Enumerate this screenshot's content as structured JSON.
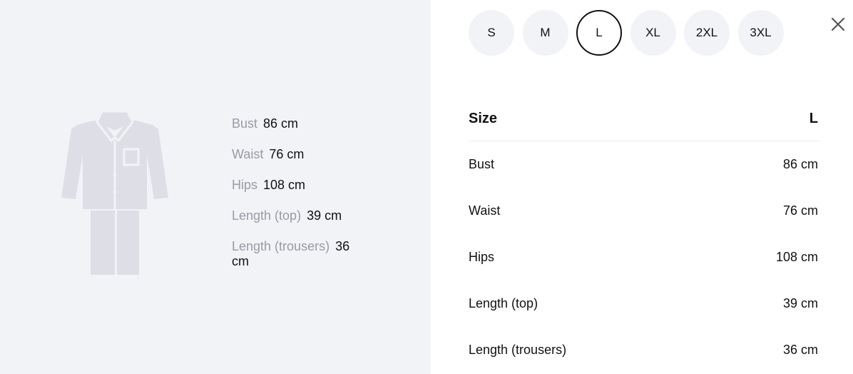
{
  "left": {
    "illustration_icon": "pajama-set-icon",
    "measurements": [
      {
        "label": "Bust",
        "value": "86 cm"
      },
      {
        "label": "Waist",
        "value": "76 cm"
      },
      {
        "label": "Hips",
        "value": "108 cm"
      },
      {
        "label": "Length (top)",
        "value": "39 cm"
      },
      {
        "label": "Length (trousers)",
        "value": "36 cm"
      }
    ]
  },
  "sizes": {
    "options": [
      "S",
      "M",
      "L",
      "XL",
      "2XL",
      "3XL"
    ],
    "selected": "L"
  },
  "close": {
    "icon": "close-icon"
  },
  "table": {
    "header": {
      "label": "Size",
      "value": "L"
    },
    "rows": [
      {
        "label": "Bust",
        "value": "86 cm"
      },
      {
        "label": "Waist",
        "value": "76 cm"
      },
      {
        "label": "Hips",
        "value": "108 cm"
      },
      {
        "label": "Length (top)",
        "value": "39 cm"
      },
      {
        "label": "Length (trousers)",
        "value": "36 cm"
      }
    ]
  },
  "colors": {
    "panel_bg": "#f2f3f6",
    "garment": "#dedfe6",
    "muted_text": "#9a9aa6",
    "text": "#111111"
  }
}
